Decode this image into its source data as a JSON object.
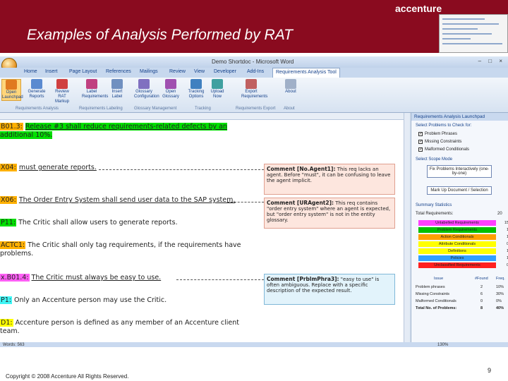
{
  "slide": {
    "brand": "accenture",
    "title": "Examples of Analysis Performed by RAT",
    "footer": "Copyright © 2008 Accenture All Rights Reserved.",
    "page_number": "9"
  },
  "window": {
    "title": "Demo Shortdoc - Microsoft Word",
    "controls": "– □ ×"
  },
  "tabs": [
    "Home",
    "Insert",
    "Page Layout",
    "References",
    "Mailings",
    "Review",
    "View",
    "Developer",
    "Add-Ins",
    "Requirements Analysis Tool"
  ],
  "ribbon": {
    "buttons": [
      "Open Launchpad",
      "Generate Reports",
      "Review RAT Markup",
      "Label Requirements",
      "Insert Label",
      "Glossary Configuration",
      "Open Glossary",
      "Tracking Options",
      "Upload Now",
      "Export Requirements",
      "About"
    ],
    "groups": [
      "Requirements Analysis",
      "Requirements Labeling",
      "Glossary Management",
      "Tracking",
      "Requirements Export",
      "About"
    ]
  },
  "document": {
    "lines": [
      {
        "id": "B01.3:",
        "text": "Release #3 shall reduce requirements-related defects by an"
      },
      {
        "id": "",
        "text": "additional 10%."
      },
      {
        "id": "X04:",
        "text": "must generate reports."
      },
      {
        "id": "X06:",
        "text": "The Order Entry System shall send user data to the SAP system."
      },
      {
        "id": "P11:",
        "text": "The Critic shall allow users to generate reports."
      },
      {
        "id": "ACTC1:",
        "text": "The Critic shall only tag requirements, if the requirements have"
      },
      {
        "id": "",
        "text": "problems."
      },
      {
        "id": "x.B01.4:",
        "text": "The Critic must always be easy to use."
      },
      {
        "id": "P1:",
        "text": "Only an Accenture person may use the Critic."
      },
      {
        "id": "D1:",
        "text": "Accenture person is defined as any member of an Accenture client"
      },
      {
        "id": "",
        "text": "team."
      }
    ],
    "comments": [
      {
        "title": "Comment [No.Agent1]:",
        "text": "This req lacks an agent. Before \"must\", it can be confusing to leave the agent implicit."
      },
      {
        "title": "Comment [URAgent2]:",
        "text": "This req contains \"order entry system\" where an agent is expected, but \"order entry system\" is not in the entity glossary."
      },
      {
        "title": "Comment [PrblmPhra3]:",
        "text": "\"easy to use\" is often ambiguous. Replace with a specific description of the expected result."
      }
    ]
  },
  "launchpad": {
    "title": "Requirements Analysis Launchpad",
    "select_label": "Select Problems to Check for:",
    "checks": [
      "Problem Phrases",
      "Missing Constraints",
      "Malformed Conditionals"
    ],
    "select_scope_label": "Select Scope Mode",
    "scope_button": "Fix Problems Interactively (one-by-one)",
    "markup_button": "Mark Up Document / Selection",
    "summary_label": "Summary Statistics",
    "total_label": "Total Requirements:",
    "total_value": "20",
    "stats": [
      {
        "label": "Unlabelled Requirements",
        "value": "15",
        "color": "#ff40ff"
      },
      {
        "label": "Problem Requirements",
        "value": "1",
        "color": "#00c000"
      },
      {
        "label": "Action Conditionals",
        "value": "1",
        "color": "#ffa000"
      },
      {
        "label": "Attribute Conditionals",
        "value": "0",
        "color": "#ffff00"
      },
      {
        "label": "Definitions",
        "value": "1",
        "color": "#ffff00"
      },
      {
        "label": "Policies",
        "value": "1",
        "color": "#30a0ff"
      },
      {
        "label": "Unclassified Requirements",
        "value": "0",
        "color": "#ff2020"
      }
    ],
    "table_headers": [
      "Issue",
      "#Found",
      "Freq."
    ],
    "table_rows": [
      [
        "Problem phrases",
        "2",
        "10%"
      ],
      [
        "Missing Constraints",
        "6",
        "30%"
      ],
      [
        "Malformed Conditionals",
        "0",
        "0%"
      ],
      [
        "Total No. of Problems:",
        "8",
        "40%"
      ]
    ]
  },
  "status": {
    "left": "Words: 563",
    "right": "130%"
  }
}
